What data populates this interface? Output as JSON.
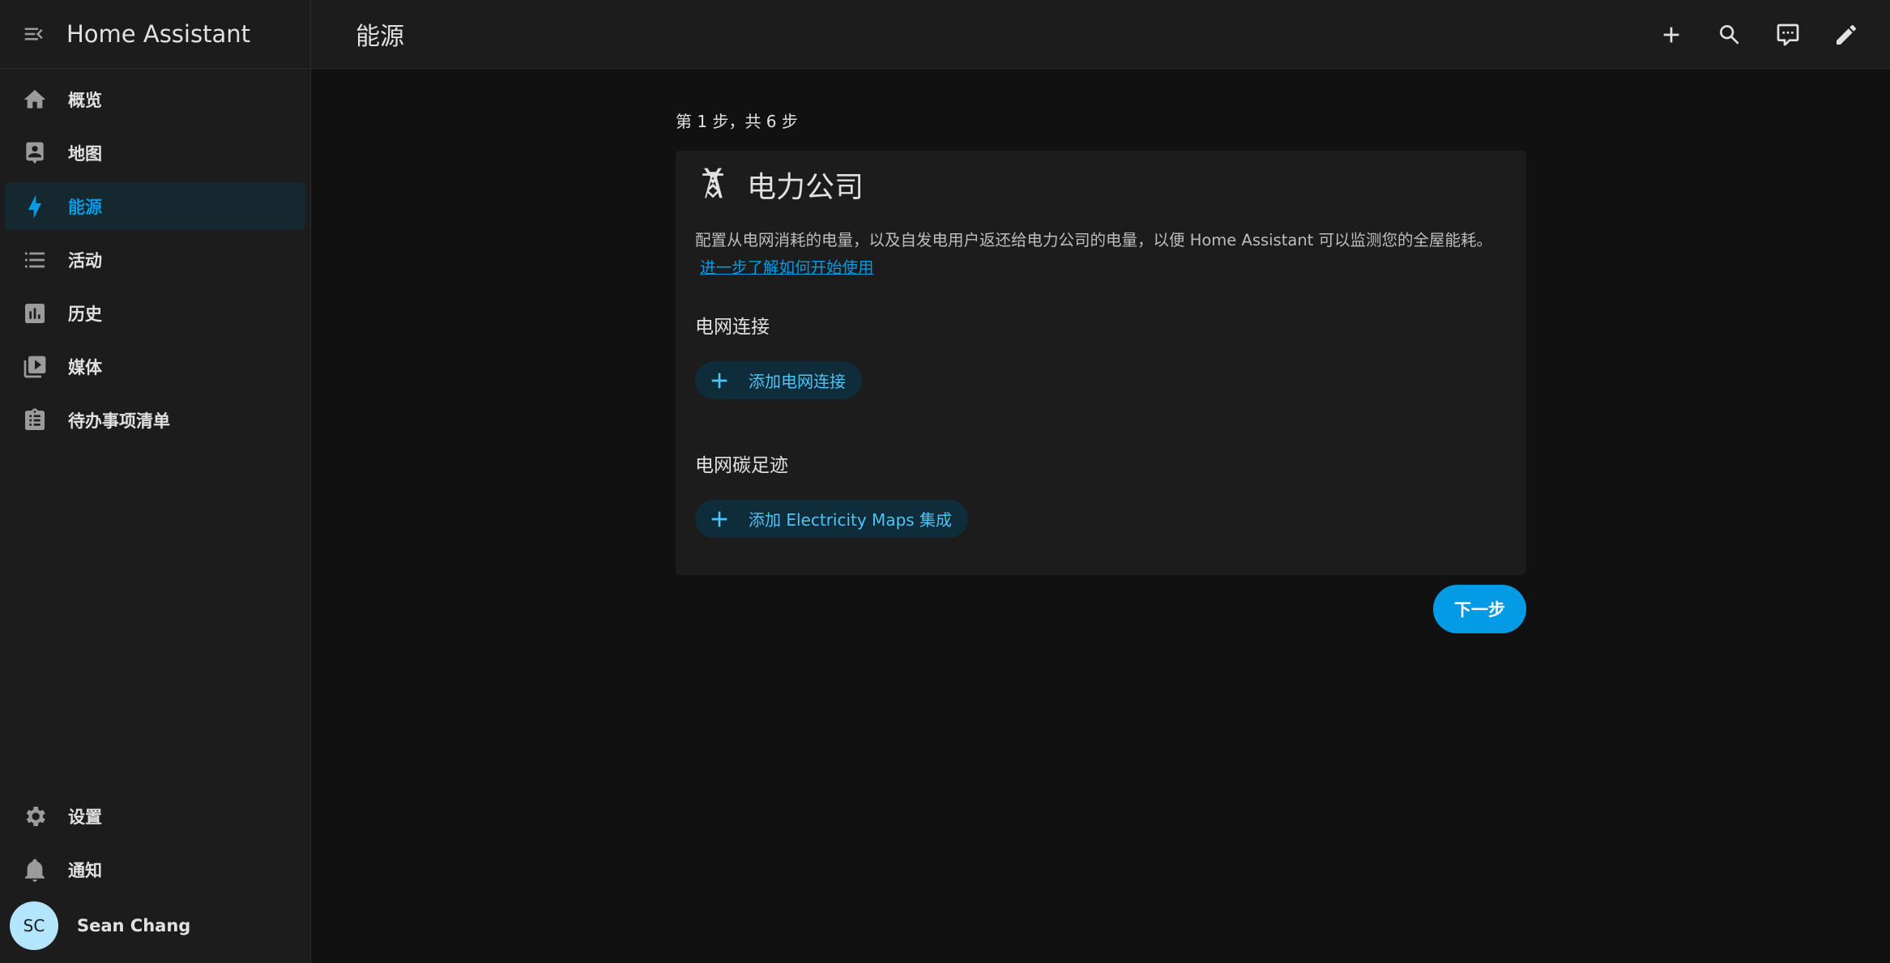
{
  "sidebar": {
    "app_title": "Home Assistant",
    "items": [
      {
        "label": "概览",
        "icon": "home-icon",
        "active": false
      },
      {
        "label": "地图",
        "icon": "map-person-icon",
        "active": false
      },
      {
        "label": "能源",
        "icon": "lightning-bolt-icon",
        "active": true
      },
      {
        "label": "活动",
        "icon": "format-list-icon",
        "active": false
      },
      {
        "label": "历史",
        "icon": "chart-box-icon",
        "active": false
      },
      {
        "label": "媒体",
        "icon": "play-box-multiple-icon",
        "active": false
      },
      {
        "label": "待办事项清单",
        "icon": "clipboard-list-icon",
        "active": false
      }
    ],
    "bottom": {
      "settings_label": "设置",
      "notifications_label": "通知",
      "user_initials": "SC",
      "user_name": "Sean Chang"
    }
  },
  "header": {
    "title": "能源",
    "actions": [
      "plus-icon",
      "search-icon",
      "assist-comment-icon",
      "pencil-icon"
    ]
  },
  "main": {
    "step_text": "第 1 步，共 6 步",
    "card": {
      "icon": "transmission-tower-icon",
      "title": "电力公司",
      "description": "配置从电网消耗的电量，以及自发电用户返还给电力公司的电量，以便 Home Assistant 可以监测您的全屋能耗。",
      "learn_more_link": "进一步了解如何开始使用",
      "grid_section_title": "电网连接",
      "add_grid_button": "添加电网连接",
      "carbon_section_title": "电网碳足迹",
      "add_carbon_button": "添加 Electricity Maps 集成"
    },
    "next_button": "下一步"
  },
  "colors": {
    "accent": "#039be5",
    "sidebar_bg": "#1c1c1c",
    "page_bg": "#111111",
    "active_item_bg": "#16282f"
  }
}
